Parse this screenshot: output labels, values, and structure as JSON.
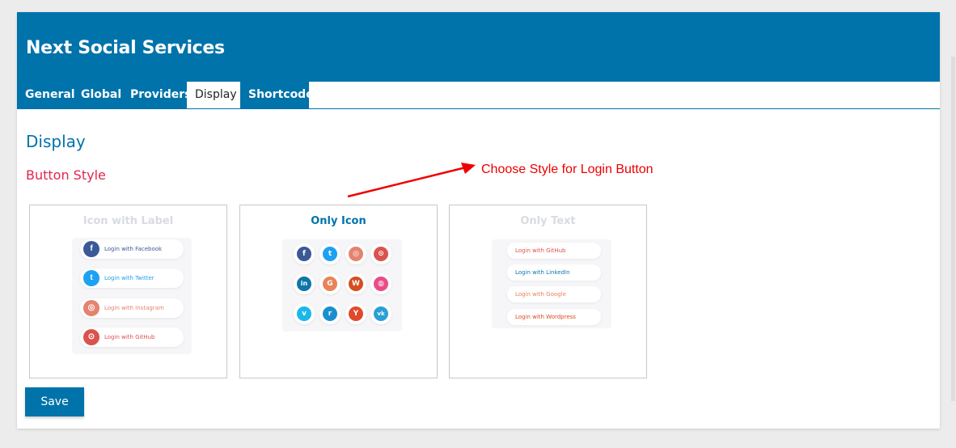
{
  "app": {
    "title": "Next Social Services"
  },
  "tabs": [
    {
      "label": "General",
      "active": false
    },
    {
      "label": "Global",
      "active": false
    },
    {
      "label": "Providers",
      "active": false
    },
    {
      "label": "Display",
      "active": true
    },
    {
      "label": "Shortcode",
      "active": false
    }
  ],
  "main": {
    "section_title": "Display",
    "sub_title": "Button Style",
    "annotation": "Choose Style for Login Button",
    "save_label": "Save"
  },
  "styles": [
    {
      "title": "Icon with Label",
      "selected": false,
      "items": [
        {
          "label": "Login with Facebook",
          "icon": "facebook-icon",
          "color": "#3b5998",
          "text_color": "#3b5998"
        },
        {
          "label": "Login with Twitter",
          "icon": "twitter-icon",
          "color": "#1da1f2",
          "text_color": "#1da1f2"
        },
        {
          "label": "Login with Instagram",
          "icon": "instagram-icon",
          "color": "#e4836f",
          "text_color": "#e4836f"
        },
        {
          "label": "Login with GitHub",
          "icon": "github-icon",
          "color": "#d9534f",
          "text_color": "#d9534f"
        }
      ]
    },
    {
      "title": "Only Icon",
      "selected": true,
      "items": [
        {
          "icon": "facebook-icon",
          "color": "#3b5998",
          "glyph": "f"
        },
        {
          "icon": "twitter-icon",
          "color": "#1da1f2",
          "glyph": "t"
        },
        {
          "icon": "instagram-icon",
          "color": "#e4836f",
          "glyph": "◎"
        },
        {
          "icon": "github-icon",
          "color": "#d9534f",
          "glyph": "⊙"
        },
        {
          "icon": "linkedin-icon",
          "color": "#0e76a8",
          "glyph": "in"
        },
        {
          "icon": "google-icon",
          "color": "#e8835a",
          "glyph": "G"
        },
        {
          "icon": "wordpress-icon",
          "color": "#d54e21",
          "glyph": "W"
        },
        {
          "icon": "dribbble-icon",
          "color": "#ea4c89",
          "glyph": "◍"
        },
        {
          "icon": "vimeo-icon",
          "color": "#1ab7ea",
          "glyph": "v"
        },
        {
          "icon": "reddit-icon",
          "color": "#1a8fcf",
          "glyph": "r"
        },
        {
          "icon": "yandex-icon",
          "color": "#e04a2b",
          "glyph": "Y"
        },
        {
          "icon": "vk-icon",
          "color": "#2a9fd6",
          "glyph": "vk"
        }
      ]
    },
    {
      "title": "Only Text",
      "selected": false,
      "items": [
        {
          "label": "Login with GitHub",
          "text_color": "#d9534f"
        },
        {
          "label": "Login with LinkedIn",
          "text_color": "#0e76a8"
        },
        {
          "label": "Login with Google",
          "text_color": "#e8835a"
        },
        {
          "label": "Login with Wordpress",
          "text_color": "#d54e21"
        }
      ]
    }
  ],
  "colors": {
    "brand": "#0073aa",
    "accent": "#e2264d",
    "annotation": "#ee0000"
  }
}
